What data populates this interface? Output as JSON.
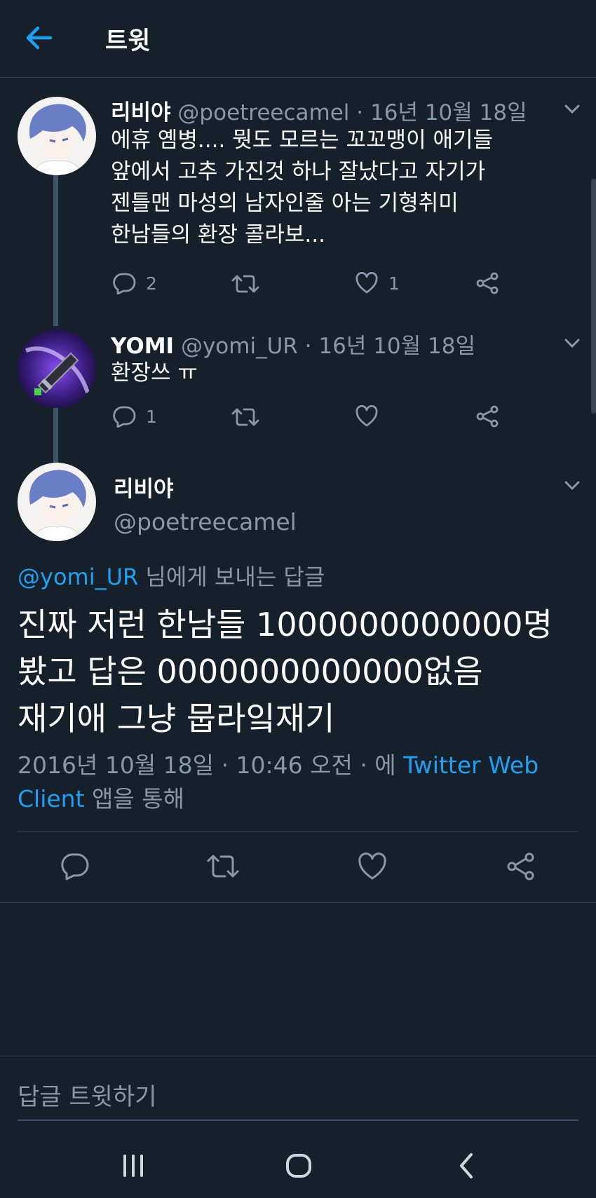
{
  "header": {
    "title": "트윗",
    "back_icon": "back-arrow-icon"
  },
  "thread": [
    {
      "display_name": "리비야",
      "handle": "@poetreecamel",
      "separator": "·",
      "date": "16년 10월 18일",
      "lines": [
        "에휴 옘병.... 뭣도 모르는 꼬꼬맹이 애기들",
        "앞에서 고추 가진것 하나 잘났다고 자기가",
        "젠틀맨 마성의 남자인줄 아는 기형취미",
        "한남들의 환장 콜라보..."
      ],
      "reply_count": "2",
      "retweet_count": "",
      "like_count": "1"
    },
    {
      "display_name": "YOMI",
      "handle": "@yomi_UR",
      "separator": "·",
      "date": "16년 10월 18일",
      "lines": [
        "환장쓰 ㅠ"
      ],
      "reply_count": "1",
      "retweet_count": "",
      "like_count": ""
    }
  ],
  "main_tweet": {
    "display_name": "리비야",
    "handle": "@poetreecamel",
    "replying_to_handle": "@yomi_UR",
    "replying_to_suffix": " 님에게 보내는 답글",
    "lines": [
      "진짜 저런 한남들 1000000000000명",
      "봤고 답은 0000000000000없음",
      "재기애 그냥 뭅라잌재기"
    ],
    "timestamp": "2016년 10월 18일 · 10:46 오전 · 에 ",
    "client": "Twitter Web Client",
    "client_suffix": " 앱을 통해"
  },
  "reply_box": {
    "placeholder": "답글 트윗하기"
  },
  "colors": {
    "background": "#15202b",
    "accent": "#1da1f2",
    "muted": "#8899a6"
  }
}
